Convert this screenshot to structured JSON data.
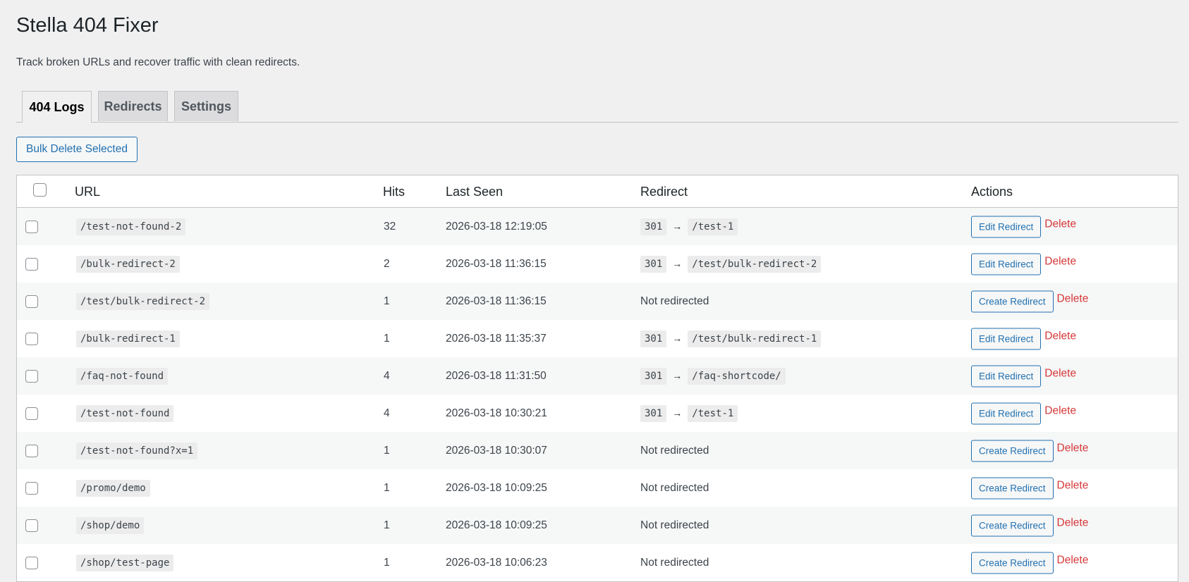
{
  "page": {
    "title": "Stella 404 Fixer",
    "subtitle": "Track broken URLs and recover traffic with clean redirects."
  },
  "tabs": [
    {
      "label": "404 Logs",
      "active": true
    },
    {
      "label": "Redirects",
      "active": false
    },
    {
      "label": "Settings",
      "active": false
    }
  ],
  "bulk_delete_label": "Bulk Delete Selected",
  "table": {
    "columns": [
      "URL",
      "Hits",
      "Last Seen",
      "Redirect",
      "Actions"
    ],
    "delete_label": "Delete",
    "not_redirected_label": "Not redirected",
    "arrow": "→",
    "rows": [
      {
        "url": "/test-not-found-2",
        "hits": "32",
        "last_seen": "2026-03-18 12:19:05",
        "redirect_code": "301",
        "redirect_target": "/test-1",
        "action": "Edit Redirect"
      },
      {
        "url": "/bulk-redirect-2",
        "hits": "2",
        "last_seen": "2026-03-18 11:36:15",
        "redirect_code": "301",
        "redirect_target": "/test/bulk-redirect-2",
        "action": "Edit Redirect"
      },
      {
        "url": "/test/bulk-redirect-2",
        "hits": "1",
        "last_seen": "2026-03-18 11:36:15",
        "redirect_code": null,
        "redirect_target": null,
        "action": "Create Redirect"
      },
      {
        "url": "/bulk-redirect-1",
        "hits": "1",
        "last_seen": "2026-03-18 11:35:37",
        "redirect_code": "301",
        "redirect_target": "/test/bulk-redirect-1",
        "action": "Edit Redirect"
      },
      {
        "url": "/faq-not-found",
        "hits": "4",
        "last_seen": "2026-03-18 11:31:50",
        "redirect_code": "301",
        "redirect_target": "/faq-shortcode/",
        "action": "Edit Redirect"
      },
      {
        "url": "/test-not-found",
        "hits": "4",
        "last_seen": "2026-03-18 10:30:21",
        "redirect_code": "301",
        "redirect_target": "/test-1",
        "action": "Edit Redirect"
      },
      {
        "url": "/test-not-found?x=1",
        "hits": "1",
        "last_seen": "2026-03-18 10:30:07",
        "redirect_code": null,
        "redirect_target": null,
        "action": "Create Redirect"
      },
      {
        "url": "/promo/demo",
        "hits": "1",
        "last_seen": "2026-03-18 10:09:25",
        "redirect_code": null,
        "redirect_target": null,
        "action": "Create Redirect"
      },
      {
        "url": "/shop/demo",
        "hits": "1",
        "last_seen": "2026-03-18 10:09:25",
        "redirect_code": null,
        "redirect_target": null,
        "action": "Create Redirect"
      },
      {
        "url": "/shop/test-page",
        "hits": "1",
        "last_seen": "2026-03-18 10:06:23",
        "redirect_code": null,
        "redirect_target": null,
        "action": "Create Redirect"
      }
    ]
  }
}
